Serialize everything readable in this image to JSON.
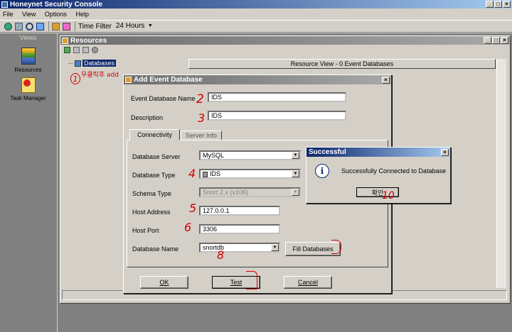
{
  "app": {
    "title": "Honeynet Security Console"
  },
  "menu": [
    "File",
    "View",
    "Options",
    "Help"
  ],
  "toolbar": {
    "time_filter_label": "Time Filter",
    "time_filter_value": "24 Hours"
  },
  "views": {
    "header": "Views",
    "items": [
      {
        "label": "Resources",
        "icon": "database-stack-icon"
      },
      {
        "label": "Task Manager",
        "icon": "task-manager-icon"
      }
    ]
  },
  "resources": {
    "title": "Resources",
    "tree_root": "Databases",
    "resource_view_header": "Resource View - 0 Event Databases"
  },
  "add_dialog": {
    "title": "Add Event Database",
    "event_db_name_label": "Event Database Name",
    "event_db_name_value": "IDS",
    "description_label": "Description",
    "description_value": "IDS",
    "tabs": [
      "Connectivity",
      "Server Info"
    ],
    "db_server_label": "Database Server",
    "db_server_value": "MySQL",
    "db_type_label": "Database Type",
    "db_type_value": "IDS",
    "schema_type_label": "Schema Type",
    "schema_type_value": "Snort 2.x (v106)",
    "host_label": "Host Address",
    "host_value": "127.0.0.1",
    "port_label": "Host Port",
    "port_value": "3306",
    "db_name_label": "Database Name",
    "db_name_value": "snortdb",
    "fill_databases": "Fill Databases",
    "ok": "OK",
    "test": "Test",
    "cancel": "Cancel"
  },
  "success_dialog": {
    "title": "Successful",
    "message": "Successfully Connected to Database",
    "ok": "확인"
  },
  "annotations": {
    "a1": "1",
    "a1_text": "우클릭후 add",
    "a2": "2",
    "a3": "3",
    "a4": "4",
    "a5": "5",
    "a6": "6",
    "a8": "8",
    "a10": "10"
  },
  "colors": {
    "title_active": "#0a246a",
    "annotation": "#d00000",
    "workspace": "#808080"
  }
}
